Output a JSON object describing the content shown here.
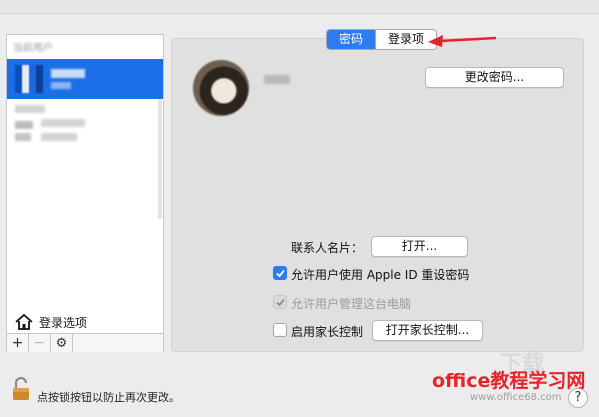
{
  "sidebar": {
    "header": "当前用户",
    "login_options_label": "登录选项",
    "toolbar": {
      "add": "+",
      "remove": "−",
      "gear": "⚙"
    }
  },
  "tabs": [
    {
      "label": "密码",
      "active": true
    },
    {
      "label": "登录项",
      "active": false
    }
  ],
  "main": {
    "change_password_button": "更改密码...",
    "contact_card_label": "联系人名片：",
    "contact_card_button": "打开...",
    "allow_appleid_reset": "允许用户使用 Apple ID 重设密码",
    "allow_admin": "允许用户管理这台电脑",
    "parental_controls": "启用家长控制",
    "open_parental_button": "打开家长控制..."
  },
  "bottom": {
    "lock_text": "点按锁按钮以防止再次更改。",
    "help": "?"
  },
  "watermark": {
    "main": "office教程学习网",
    "sub": "www.office68.com"
  },
  "colors": {
    "accent": "#2d7cf6",
    "arrow": "#e0262c",
    "watermark": "#e8242a"
  }
}
